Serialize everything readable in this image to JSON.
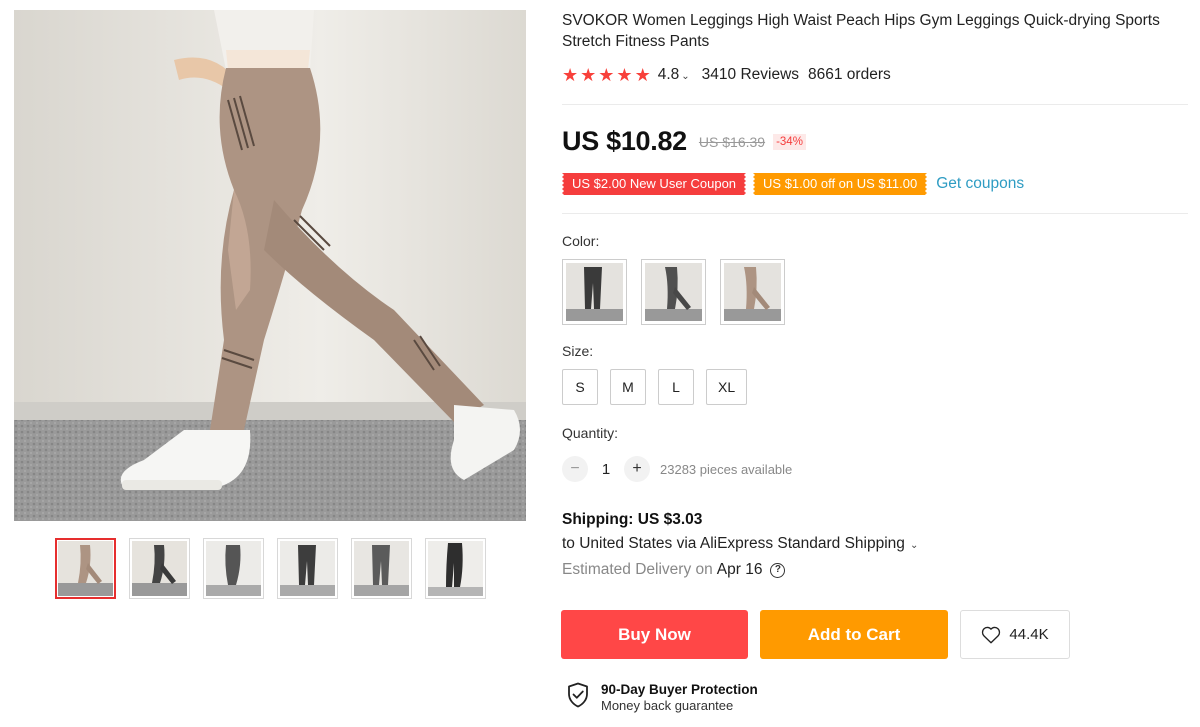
{
  "product": {
    "title": "SVOKOR Women Leggings High Waist Peach Hips Gym Leggings Quick-drying Sports Stretch Fitness Pants",
    "rating": "4.8",
    "rating_stars": 5,
    "reviews": "3410 Reviews",
    "orders": "8661 orders"
  },
  "price": {
    "current": "US $10.82",
    "original": "US $16.39",
    "discount": "-34%"
  },
  "coupons": {
    "items": [
      "US $2.00 New User Coupon",
      "US $1.00 off on US $11.00"
    ],
    "link": "Get coupons"
  },
  "color": {
    "label": "Color:",
    "options": [
      "dark grey",
      "grey",
      "khaki"
    ]
  },
  "size": {
    "label": "Size:",
    "options": [
      "S",
      "M",
      "L",
      "XL"
    ]
  },
  "quantity": {
    "label": "Quantity:",
    "minus": "−",
    "plus": "+",
    "value": "1",
    "available": "23283 pieces available"
  },
  "shipping": {
    "title": "Shipping: US $3.03",
    "destination": "to United States via AliExpress Standard Shipping",
    "estimate_label": "Estimated Delivery on",
    "estimate_date": "Apr 16",
    "help": "?"
  },
  "actions": {
    "buy_now": "Buy Now",
    "add_to_cart": "Add to Cart",
    "wishlist_count": "44.4K"
  },
  "protection": {
    "title": "90-Day Buyer Protection",
    "subtitle": "Money back guarantee"
  },
  "gallery": {
    "thumbnail_count": 6,
    "active_index": 0
  },
  "colors": {
    "accent_red": "#ff4747",
    "accent_orange": "#ff9a00",
    "link_blue": "#2e9cc3",
    "star": "#f8403a"
  },
  "icons": {
    "chevron": "chevron-down-icon",
    "wishlist": "heart-icon",
    "protection": "shield-check-icon",
    "help": "question-circle-icon",
    "star": "star-icon"
  }
}
